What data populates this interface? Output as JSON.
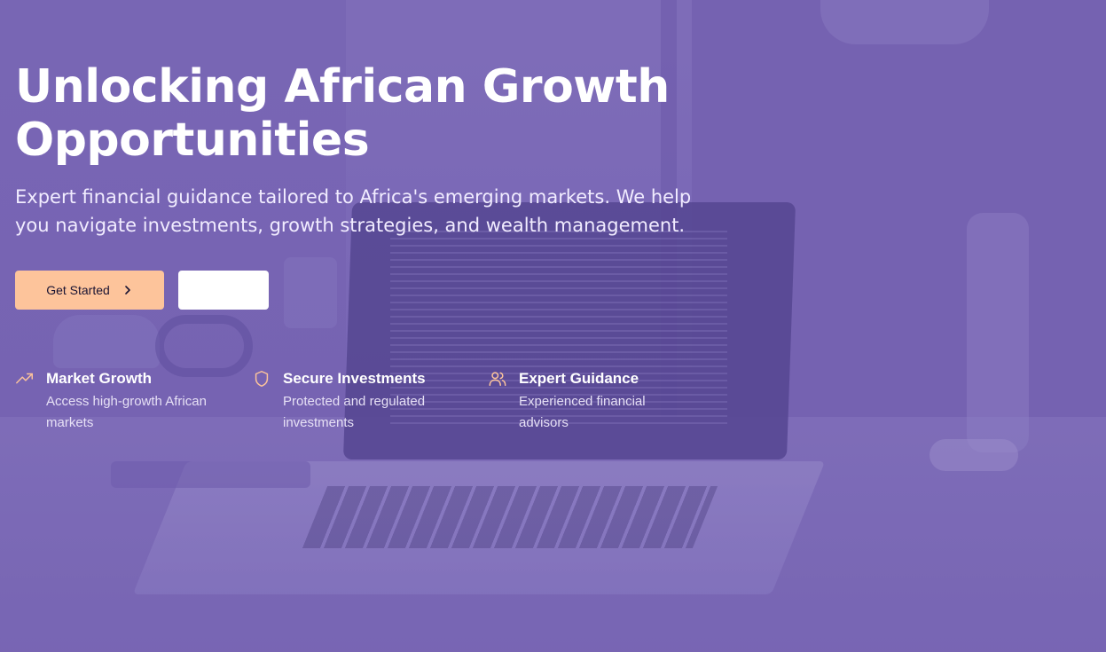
{
  "hero": {
    "title": "Unlocking African Growth Opportunities",
    "subtitle": "Expert financial guidance tailored to Africa's emerging markets. We help you navigate investments, growth strategies, and wealth management.",
    "primary_button_label": "Get Started",
    "secondary_button_label": ""
  },
  "features": [
    {
      "icon": "trending-up-icon",
      "title": "Market Growth",
      "description": "Access high-growth African markets"
    },
    {
      "icon": "shield-icon",
      "title": "Secure Investments",
      "description": "Protected and regulated investments"
    },
    {
      "icon": "users-icon",
      "title": "Expert Guidance",
      "description": "Experienced financial advisors"
    }
  ],
  "colors": {
    "overlay": "#7563b0",
    "accent": "#fdc49b",
    "text": "#ffffff"
  }
}
